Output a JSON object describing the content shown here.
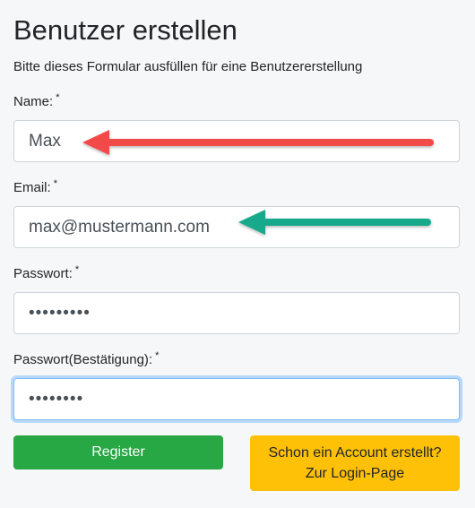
{
  "page": {
    "title": "Benutzer erstellen",
    "subtitle": "Bitte dieses Formular ausfüllen für eine Benutzererstellung"
  },
  "form": {
    "required_marker": "*",
    "name": {
      "label": "Name:",
      "value": "Max"
    },
    "email": {
      "label": "Email:",
      "value": "max@mustermann.com"
    },
    "password": {
      "label": "Passwort:",
      "value": "•••••••••"
    },
    "password_confirm": {
      "label": "Passwort(Bestätigung):",
      "value": "••••••••"
    }
  },
  "buttons": {
    "register_label": "Register",
    "login_line1": "Schon ein Account erstellt?",
    "login_line2": "Zur Login-Page"
  },
  "colors": {
    "red_arrow": "#f24848",
    "teal_arrow": "#13a98b",
    "register_bg": "#28a745",
    "login_bg": "#ffc107",
    "focus_border": "#80bdff"
  }
}
